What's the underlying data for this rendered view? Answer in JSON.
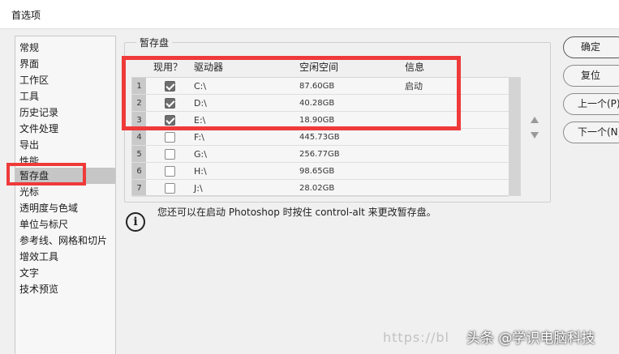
{
  "window": {
    "title": "首选项"
  },
  "nav": {
    "items": [
      {
        "label": "常规"
      },
      {
        "label": "界面"
      },
      {
        "label": "工作区"
      },
      {
        "label": "工具"
      },
      {
        "label": "历史记录"
      },
      {
        "label": "文件处理"
      },
      {
        "label": "导出"
      },
      {
        "label": "性能"
      },
      {
        "label": "暂存盘",
        "selected": true
      },
      {
        "label": "光标"
      },
      {
        "label": "透明度与色域"
      },
      {
        "label": "单位与标尺"
      },
      {
        "label": "参考线、网格和切片"
      },
      {
        "label": "增效工具"
      },
      {
        "label": "文字"
      },
      {
        "label": "技术预览"
      }
    ]
  },
  "scratch": {
    "legend": "暂存盘",
    "headers": {
      "active": "现用？",
      "drive": "驱动器",
      "free": "空闲空间",
      "info": "信息"
    },
    "rows": [
      {
        "num": "1",
        "checked": true,
        "drive": "C:\\",
        "free": "87.60GB",
        "info": "启动"
      },
      {
        "num": "2",
        "checked": true,
        "drive": "D:\\",
        "free": "40.28GB",
        "info": ""
      },
      {
        "num": "3",
        "checked": true,
        "drive": "E:\\",
        "free": "18.90GB",
        "info": ""
      },
      {
        "num": "4",
        "checked": false,
        "drive": "F:\\",
        "free": "445.73GB",
        "info": ""
      },
      {
        "num": "5",
        "checked": false,
        "drive": "G:\\",
        "free": "256.77GB",
        "info": ""
      },
      {
        "num": "6",
        "checked": false,
        "drive": "H:\\",
        "free": "98.65GB",
        "info": ""
      },
      {
        "num": "7",
        "checked": false,
        "drive": "J:\\",
        "free": "28.02GB",
        "info": ""
      }
    ],
    "tip": "您还可以在启动 Photoshop 时按住 control-alt 来更改暂存盘。"
  },
  "buttons": {
    "ok": "确定",
    "reset": "复位",
    "prev": "上一个(P)",
    "next": "下一个(N)"
  },
  "watermark": {
    "url": "https://bl",
    "text": "头条 @学识电脑科技"
  },
  "colors": {
    "highlight": "#ef3a3a",
    "selected_nav": "#c6c6c6"
  }
}
